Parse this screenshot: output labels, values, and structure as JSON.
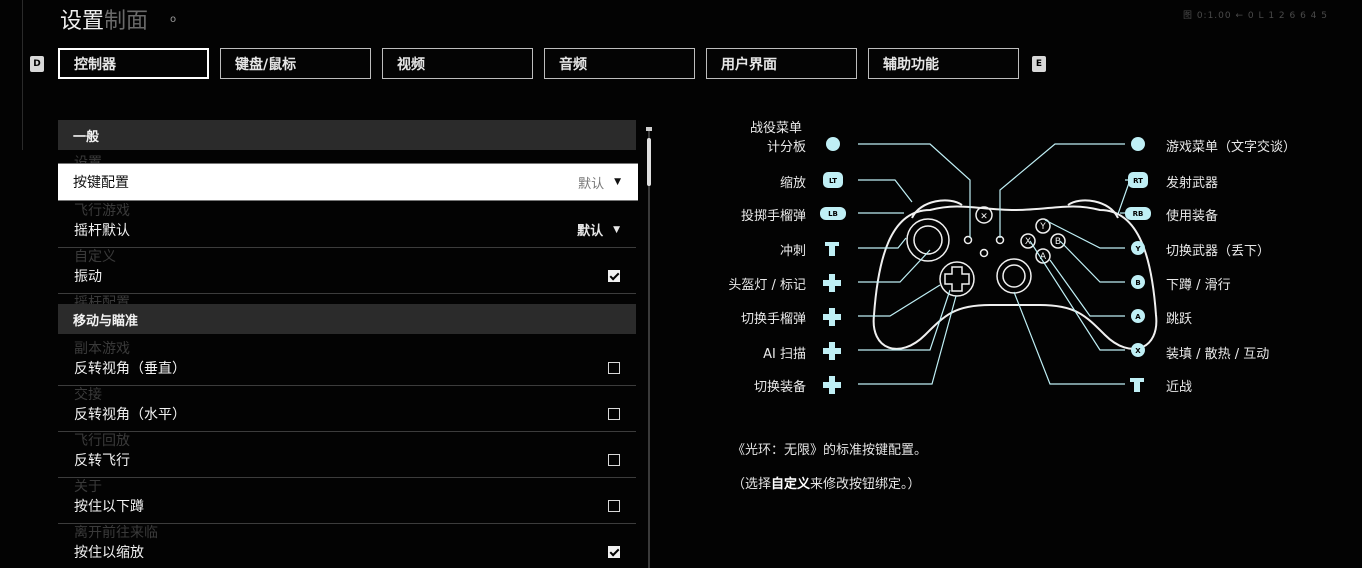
{
  "header": {
    "title": "设置",
    "title_ghost": "制面",
    "dot": "o",
    "top_right": "图 0:1.00 ← 0 L 1 2 6 6 4 5"
  },
  "tabs": {
    "left_bumper": "D",
    "right_bumper": "E",
    "items": [
      "控制器",
      "键盘/鼠标",
      "视频",
      "音频",
      "用户界面",
      "辅助功能"
    ],
    "active_index": 0
  },
  "settings": {
    "sections": [
      "一般",
      "移动与瞄准"
    ],
    "rows": {
      "button_layout": {
        "label": "按键配置",
        "value": "默认"
      },
      "stick_default": {
        "label": "摇杆默认",
        "value": "默认"
      },
      "vibration": {
        "label": "振动",
        "checked": true
      },
      "invert_look_v": {
        "label": "反转视角（垂直）",
        "checked": false
      },
      "invert_look_h": {
        "label": "反转视角（水平）",
        "checked": false
      },
      "invert_flight": {
        "label": "反转飞行",
        "checked": false
      },
      "hold_crouch": {
        "label": "按住以下蹲",
        "checked": false
      },
      "hold_zoom": {
        "label": "按住以缩放",
        "checked": true
      }
    },
    "ghost_labels": [
      "设置",
      "飞行游戏",
      "自定义",
      "摇杆配置",
      "副本游戏",
      "交接",
      "飞行回放",
      "关于",
      "离开前往来临"
    ]
  },
  "controller": {
    "left_labels": [
      "战役菜单",
      "计分板",
      "缩放",
      "投掷手榴弹",
      "冲刺",
      "头盔灯 / 标记",
      "切换手榴弹",
      "AI 扫描",
      "切换装备"
    ],
    "right_labels": [
      "游戏菜单（文字交谈）",
      "发射武器",
      "使用装备",
      "切换武器（丢下）",
      "下蹲 / 滑行",
      "跳跃",
      "装填 / 散热 / 互动",
      "近战"
    ],
    "left_icons": [
      "view",
      "LT",
      "LB",
      "L",
      "+",
      "+",
      "+",
      "+"
    ],
    "right_icons": [
      "≡",
      "RT",
      "RB",
      "Y",
      "B",
      "A",
      "X",
      "R"
    ],
    "accent_color": "#bfeff5"
  },
  "description": {
    "line1": "《光环：无限》的标准按键配置。",
    "line2_pre": "（选择",
    "line2_bold": "自定义",
    "line2_post": "来修改按钮绑定。）"
  }
}
